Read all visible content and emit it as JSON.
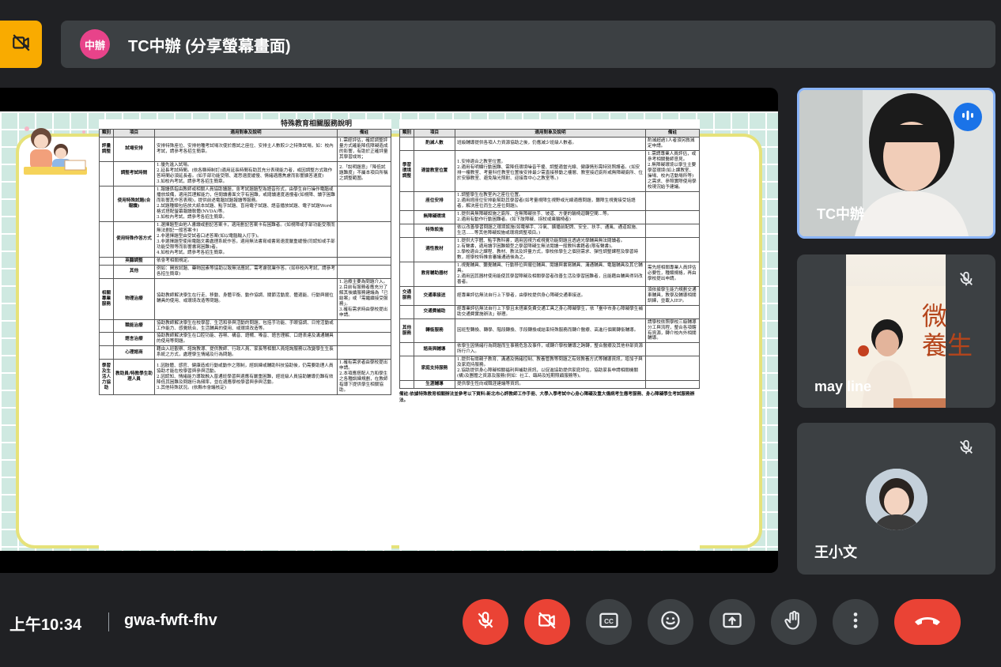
{
  "presenter": {
    "avatar_initials": "中辦",
    "title": "TC中辦 (分享螢幕畫面)"
  },
  "document": {
    "title": "特殊教育相關服務說明",
    "left_headers": [
      "類別",
      "項目",
      "適用對象及說明",
      "備註"
    ],
    "left_rows": [
      {
        "cat": "評量調整",
        "item": "試場安排",
        "desc": "安排特殊座位、安排他種考試場次使於應試之座位、安排主人數較少之特殊試場，如：校內考試，請參考各招生簡章。",
        "note": "1.需經評估，確認調整評量方式確能降低障礙造成的影響，有助於正確評量其學習成效；"
      },
      {
        "cat": "",
        "item": "調整考試時間",
        "desc": "1.優先進入試場。\n2.延長考試時間。(依各縣時制訂)適用延長時間有助其充分表現能力者，或因調整方式致作答時間必須延長者。(如手部功能受限、運思速度緩慢、情緒適應焦慮而影響擴答速度)\n3.如校內考試，請參考各招生簡章。",
        "note": "2.「說明題意」「降低試題難度」不屬本項目所稱之調整範圍。"
      },
      {
        "cat": "",
        "item": "使用特殊試題(合報讀)",
        "desc": "1.報讀係指由教師或相關人員協助讀題，會考試題題型為語音形式，由學生自行操作電腦或播放設備，適用其理解能力，但閱讀書面文字有困難，或閱讀速度過慢者(如視障、讀字困難而影響其作答表現)，提供前述電腦試題報讀等服務。\n2.試題種類包括放大紙本試題、點字試題、盲用電子試題、語音播放試題、電子試題Word格式搭配螢幕報讀軟體(NVDA)等。\n3.如校內考試，請參考各招生簡章。",
        "note": ""
      },
      {
        "cat": "",
        "item": "使用特殊作答方式",
        "desc": "1.選擇題型由他人書讀或劃記答案卡，適用劃記答案卡有困難者。(如視障或手部功能受限而無法劃記一般答案卡)\n2.非選擇題型由受試者口述答案(如以電腦輸入打字)。\n3.非選擇題型使用電腦文書處理系統作答，適用無法書寫或書寫速度嚴重緩慢(同認知或手部功能受限等而影響書寫困難)者。\n4.如校內考試，請參考各招生簡章。",
        "note": ""
      },
      {
        "cat": "",
        "item": "英聽調整",
        "desc": "依會考相關規定。",
        "note": ""
      },
      {
        "cat": "",
        "item": "其他",
        "desc": "例如：開放試題、藥物因素等協助以致無法應試，需考慮就業作答。(如非校內考試，請參考各招生簡章)",
        "note": ""
      },
      {
        "cat": "相關專業服務",
        "item": "物理治療",
        "desc": "協助教師解決學生在行走、移動、身體平衡、動作協調、關節活動度、體適能、行動與擺位輔具的使用、或環境改造等問題。",
        "note": "1.治療主要為問題介入。\n2.目前有服務者應充分了解其後續服務建議為「已結案」或「需繼續接受服務」。\n3.確有需求時由學校提出申請。"
      },
      {
        "cat": "",
        "item": "職能治療",
        "desc": "協助教師解決學生在校學習、生活和參與活動的問題，包括手功能、手眼協調、日常活動或工作能力、感覺統合、生活輔具的使用、或環境改造等。",
        "note": ""
      },
      {
        "cat": "",
        "item": "語言治療",
        "desc": "協助教師解決學生在口腔功能、吞嚥、構音、語暢、嗓音、語言理解、口語表達及溝通輔具的使用等問題。",
        "note": ""
      },
      {
        "cat": "",
        "item": "心理諮商",
        "desc": "藉由入班觀察、諮詢教導、提供教師、行政人員、家長等相關人員諮詢服務以改變學生生長系統之方式，處理學生情緒及行為問題。",
        "note": ""
      },
      {
        "cat": "學習及生活人力協助",
        "item": "教助員/特教學生助理人員",
        "desc": "1.因肢體、感官、健康造成行動或動作之限制，經訓練或輔助科技協助後，仍需要助理人員協助才能在校學習與參與活動。\n2.因認知、情緒能力導致融入普通班學習與適應有嚴重困難，經班級人員協助輔導仍難有效降低其困難及問題行為頻率，並在適應學校學習與參與活動。\n3.其他特殊狀況。(依縣市會議核定)",
        "note": "1.確有需求者由學校提出申請。\n2.本項應搭配人力和學生之各種訓練規劃，在教師指導下提供學生相關協助。"
      }
    ],
    "right_headers": [
      "類別",
      "項目",
      "適用對象及說明",
      "備註"
    ],
    "right_rows": [
      {
        "cat": "",
        "item": "酌減人數",
        "desc": "班級輔導提供各項人力資源協助之後，仍應減少班級人數者。",
        "note": "酌減超過1人者須另敘減定申請。"
      },
      {
        "cat": "學習環境調整",
        "item": "適當教室位置",
        "desc": "1.安排適合之教室位置。\n2.適用有明顯行動困難、需降低環境噪音干擾、調整適當光線、健康情形需特別照護者。(如安排一樓教室、考量科任教室位置後安排最少需直接移動之樓層、教室接近廁所或無障礙廁所、位於安靜教室、避免陰光照射、迎接靠中心之教室等。)",
        "note": "1.需請專業人員評估，或參考相關醫師意見。\n2.無障礙環境以學生主要學習環境(如上課教室、操場、校內活動場所等)之需求、參照實際使用學校現況給予建議。"
      },
      {
        "cat": "",
        "item": "座位安排",
        "desc": "1.調整學生在教室內之座位位置。\n2.適用經座位安排能幫助其學習者(如考量視障生視野或光線適應問題，聽障生視覺接受話語者，解決座位而生之座位問題)。",
        "note": ""
      },
      {
        "cat": "",
        "item": "無障礙環境",
        "desc": "1.提供具無障礙設施之廁所、含無障礙扶手、坡道、方便的輪椅迴轉空間...等。\n2.適用有動作行動困難者。(如下肢障礙、拐杖或乘輪椅者)",
        "note": ""
      },
      {
        "cat": "",
        "item": "特殊設施",
        "desc": "依以改善學習問題之環境設施(如電梯手、冷氣、擴播前配牌、安全、扶手、通風、通道設施、生活......等其他障礙設施或環境調整項目。)",
        "note": ""
      },
      {
        "cat": "",
        "item": "適性教材",
        "desc": "1.提供大字體、點字教科書，適用因視力或視覺功能問題且透過光學輔具無法閱讀者。\n2.有聲書，適用讀字困難類型之學習障礙生無法閱讀一般教科書籍者(限有聲書)。\n3.學校適合之課程、教材、教法及評量方式，學校依學生之個別需求、彈性調整課程及學習時數，經學校特推會審議通過後為之。",
        "note": ""
      },
      {
        "cat": "",
        "item": "教育輔助器材",
        "desc": "1.視覺輔具、聽覺輔具、行動移位與擺位輔具、閱讀與書寫輔具、溝通輔具、電腦輔具及其它輔具。\n2.適用因其器材使用能使其學習障礙及相關學習者改善生活及學習困難者，且能藉由輔具得到改善者。",
        "note": "需先經相關專業人員評估必要性，種類規格，再由學校提出申請。"
      },
      {
        "cat": "交通服務",
        "item": "交通車接送",
        "desc": "經專業評估無法自行上下學者，由學校提供身心障礙交通車接送。",
        "note": "須依據學生能力規劃交通車輔具，教學及輔導相關訓練，並載入IEP。"
      },
      {
        "cat": "",
        "item": "交通費補助",
        "desc": "經專業評估無法自行上下學且未搭乘免費交通工具之身心障礙學生，依「臺中市身心障礙學生補助交通費實施辦法」辦理。",
        "note": ""
      },
      {
        "cat": "其他服務",
        "item": "轉銜服務",
        "desc": "因班型轉換、轉學、階段轉換、手段轉換或結束特殊服務而轉介醫療、高進行個案轉銜輔導。",
        "note": "請學校依照學校三級輔導分工與流程，整合各項轄有資源，轉介校內外相關輔導。"
      },
      {
        "cat": "",
        "item": "諮商與輔導",
        "desc": "依學生因情緒行為問題而生事務危急及事件，或轉介學校輔導之跨轉，整合醫療及其他非部資源所行介入。",
        "note": ""
      },
      {
        "cat": "",
        "item": "家庭支持服務",
        "desc": "1.提供有關親子教育、溝通及情緒控制、教養管教等問題之有效教養方式等輔導資訊，增加子與及家庭持服務。\n2.協助提供身心障礙相關福利與補助資訊，以促進協助提供家庭評估，協助家長申請相關機關(構)及團體之資源及服務(例如：社工、臨時及短期照顧服務等)。",
        "note": ""
      },
      {
        "cat": "",
        "item": "生涯輔導",
        "desc": "提供學生性向或職涯建議等資訊。",
        "note": ""
      }
    ],
    "footnote": "備註:依據特殊教育相關辦法並參考以下資料:新北市心評教師工作手冊、大學入學考試中心身心障礙及重大傷病考生應考服務、身心障礙學生考試服務辦法。"
  },
  "participants": [
    {
      "name": "TC中辦",
      "state": "speaking"
    },
    {
      "name": "may line",
      "state": "muted",
      "book_text": "微\n養生"
    },
    {
      "name": "王小文",
      "state": "muted"
    }
  ],
  "footer": {
    "time": "上午10:34",
    "meeting_code": "gwa-fwft-fhv"
  },
  "icons": {
    "camera_off": "camera-off-icon",
    "speaking": "audio-bars-icon",
    "muted": "mic-off-icon",
    "controls": [
      "mic-off-icon",
      "camera-off-icon",
      "captions-icon",
      "emoji-icon",
      "present-icon",
      "raise-hand-icon",
      "more-vert-icon",
      "end-call-icon"
    ]
  },
  "colors": {
    "background": "#202124",
    "surface": "#3c4043",
    "accent_red": "#ea4335",
    "camera_badge": "#f9ab00",
    "speaking_blue": "#1a73e8",
    "active_border": "#8ab4f8"
  }
}
